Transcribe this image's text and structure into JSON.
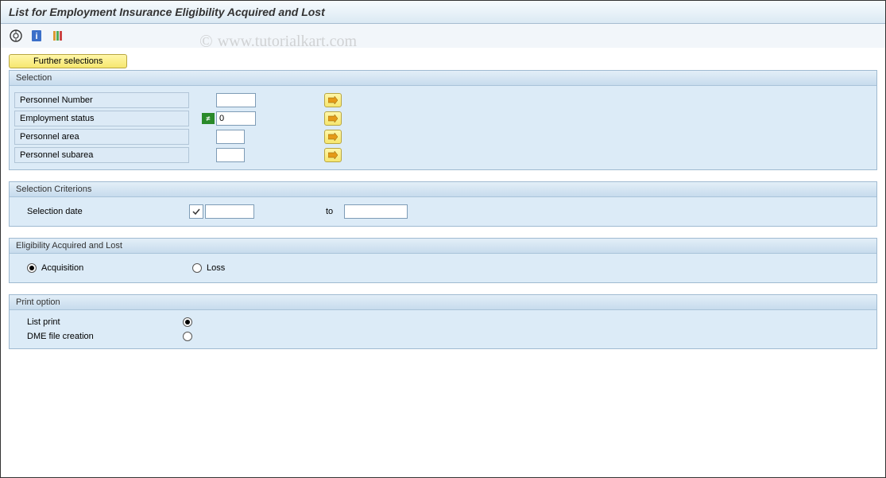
{
  "title": "List for Employment Insurance Eligibility Acquired and Lost",
  "watermark": "www.tutorialkart.com",
  "buttons": {
    "further_selections": "Further selections"
  },
  "groups": {
    "selection": {
      "title": "Selection",
      "fields": {
        "personnel_number": "Personnel Number",
        "employment_status": "Employment status",
        "employment_status_value": "0",
        "personnel_area": "Personnel area",
        "personnel_subarea": "Personnel subarea"
      }
    },
    "criterions": {
      "title": "Selection Criterions",
      "selection_date": "Selection date",
      "to": "to"
    },
    "eligibility": {
      "title": "Eligibility Acquired and Lost",
      "acquisition": "Acquisition",
      "loss": "Loss"
    },
    "print_option": {
      "title": "Print option",
      "list_print": "List print",
      "dme_file": "DME file creation"
    }
  }
}
